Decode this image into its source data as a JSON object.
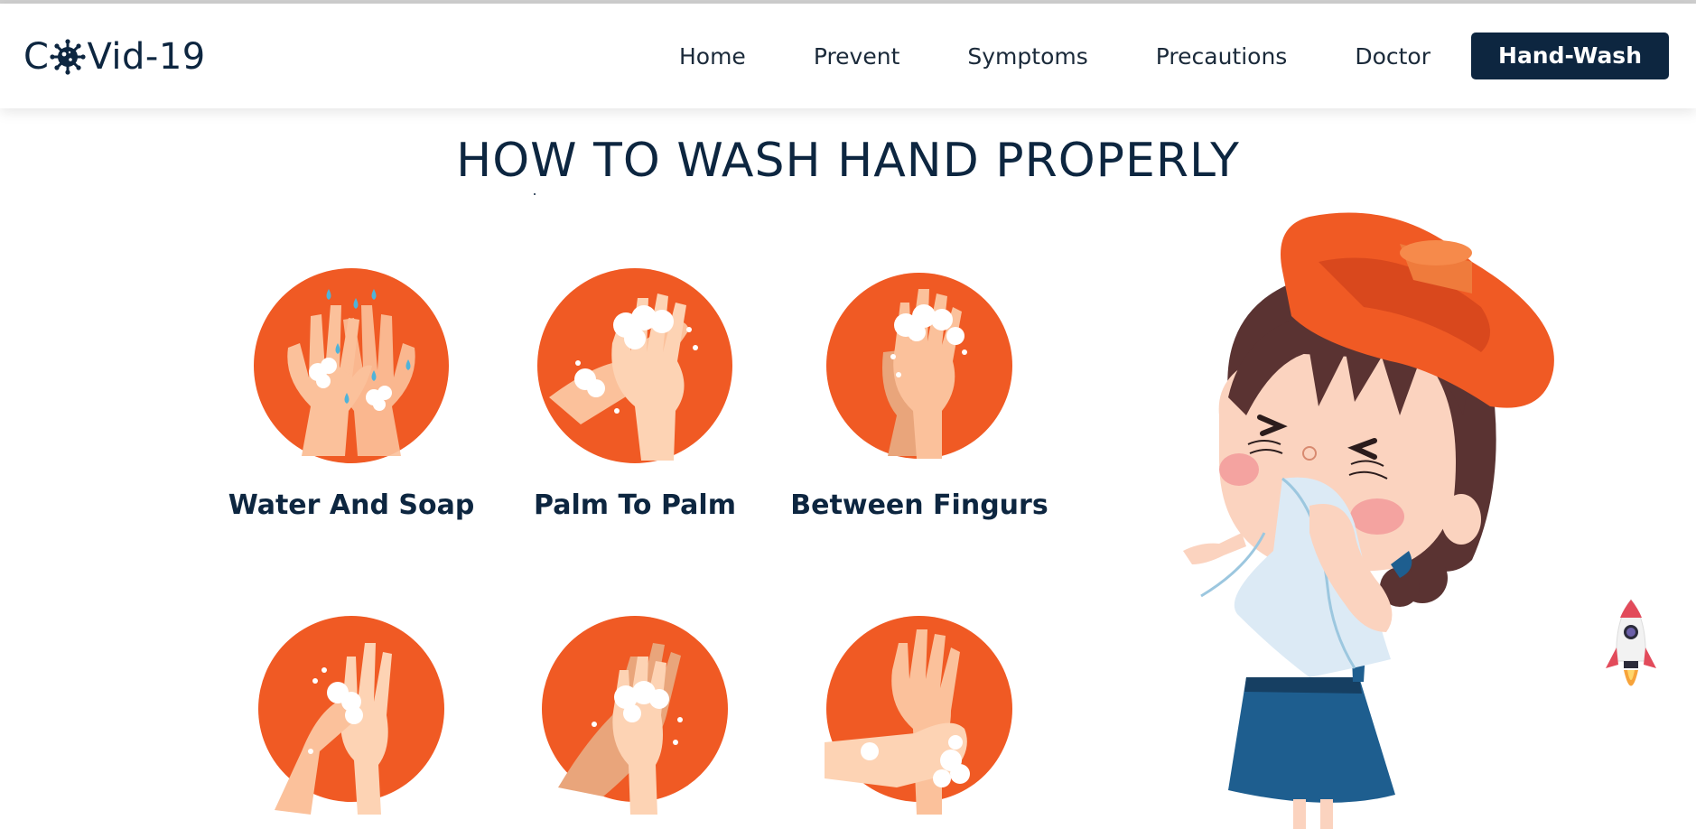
{
  "logo": {
    "prefix": "C",
    "suffix": "Vid-19",
    "icon": "virus-icon"
  },
  "nav": {
    "items": [
      "Home",
      "Prevent",
      "Symptoms",
      "Precautions",
      "Doctor"
    ],
    "active": "Hand-Wash"
  },
  "page_title": "HOW TO WASH HAND PROPERLY",
  "steps": [
    {
      "label": "Water And Soap",
      "icon": "hands-water-soap-icon"
    },
    {
      "label": "Palm To Palm",
      "icon": "palm-to-palm-icon"
    },
    {
      "label": "Between Fingurs",
      "icon": "between-fingers-icon"
    },
    {
      "label": "",
      "icon": "thumb-wash-icon"
    },
    {
      "label": "",
      "icon": "back-of-hands-icon"
    },
    {
      "label": "",
      "icon": "wrist-wash-icon"
    }
  ],
  "colors": {
    "brand_navy": "#0d2640",
    "accent_orange": "#f05a24",
    "skin": "#fbc19b",
    "foam": "#ffffff",
    "water": "#4fb3d9"
  },
  "illustration": "sick-girl-with-ice-pack",
  "scroll_widget": "rocket-icon"
}
